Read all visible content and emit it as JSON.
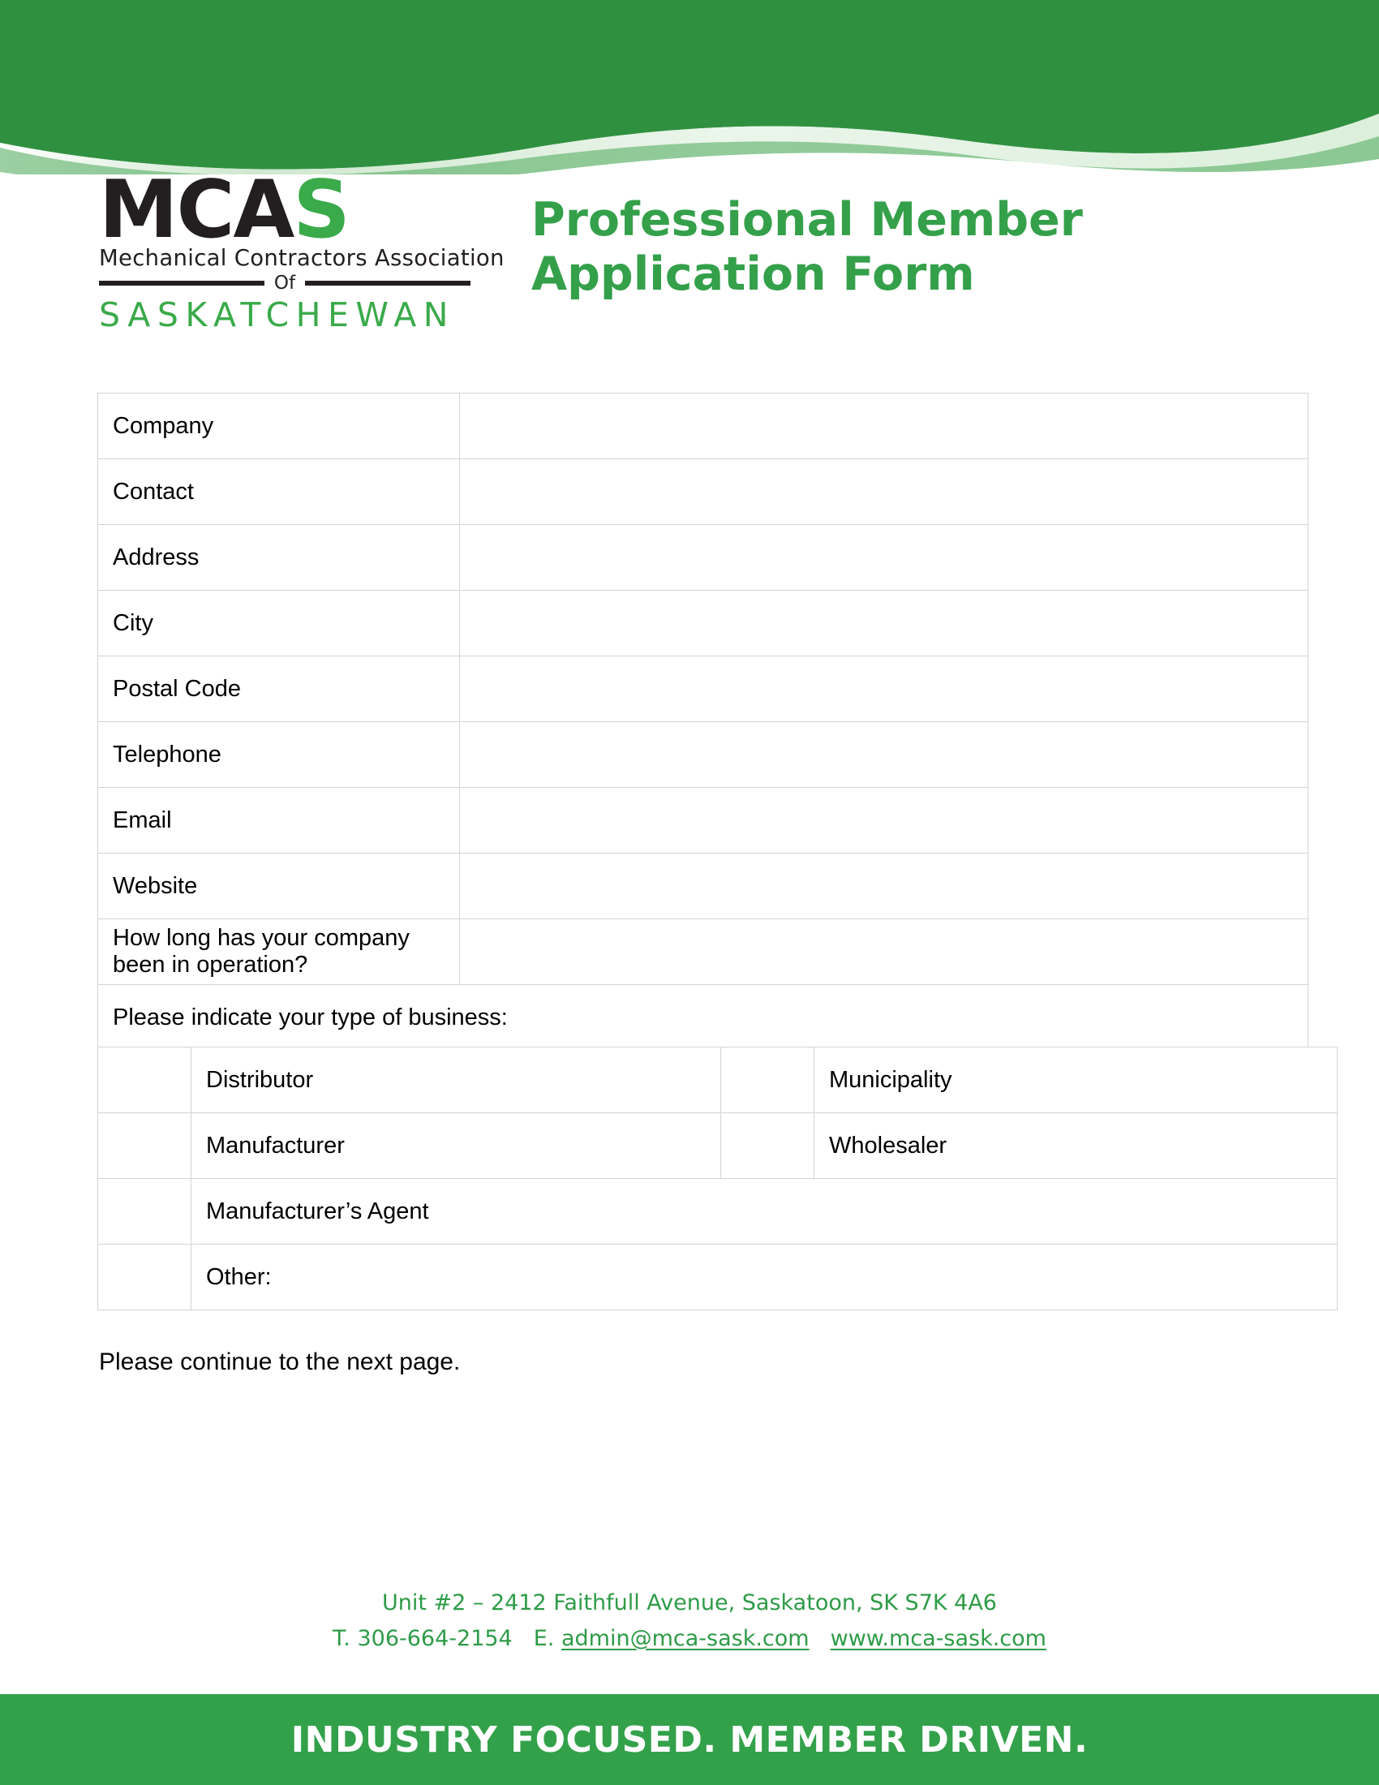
{
  "brand": {
    "accent_green": "#33a14a",
    "logo_dark": "#231f20",
    "logo_acronym_black": "MCA",
    "logo_acronym_green": "S",
    "logo_subtitle": "Mechanical Contractors Association",
    "logo_of": "Of",
    "logo_province": "SASKATCHEWAN"
  },
  "header": {
    "title_line1": "Professional  Member",
    "title_line2": "Application Form"
  },
  "form": {
    "fields": [
      {
        "label": "Company",
        "value": ""
      },
      {
        "label": "Contact",
        "value": ""
      },
      {
        "label": "Address",
        "value": ""
      },
      {
        "label": "City",
        "value": ""
      },
      {
        "label": "Postal Code",
        "value": ""
      },
      {
        "label": "Telephone",
        "value": ""
      },
      {
        "label": "Email",
        "value": ""
      },
      {
        "label": "Website",
        "value": ""
      }
    ],
    "operation_question": {
      "label": "How long has your company been in operation?",
      "value": ""
    },
    "business_type_prompt": "Please indicate your type of business:",
    "business_types": [
      {
        "left": "Distributor",
        "right": "Municipality"
      },
      {
        "left": "Manufacturer",
        "right": "Wholesaler"
      },
      {
        "left": "Manufacturer’s Agent",
        "right": ""
      },
      {
        "left": "Other:",
        "right": ""
      }
    ]
  },
  "notes": {
    "continue": "Please continue to the next page."
  },
  "footer": {
    "address": "Unit #2 – 2412 Faithfull Avenue, Saskatoon, SK  S7K 4A6",
    "phone": "T. 306-664-2154",
    "email_prefix": "E.",
    "email": "admin@mca-sask.com",
    "website": "www.mca-sask.com",
    "tagline": "INDUSTRY FOCUSED.  MEMBER DRIVEN."
  }
}
